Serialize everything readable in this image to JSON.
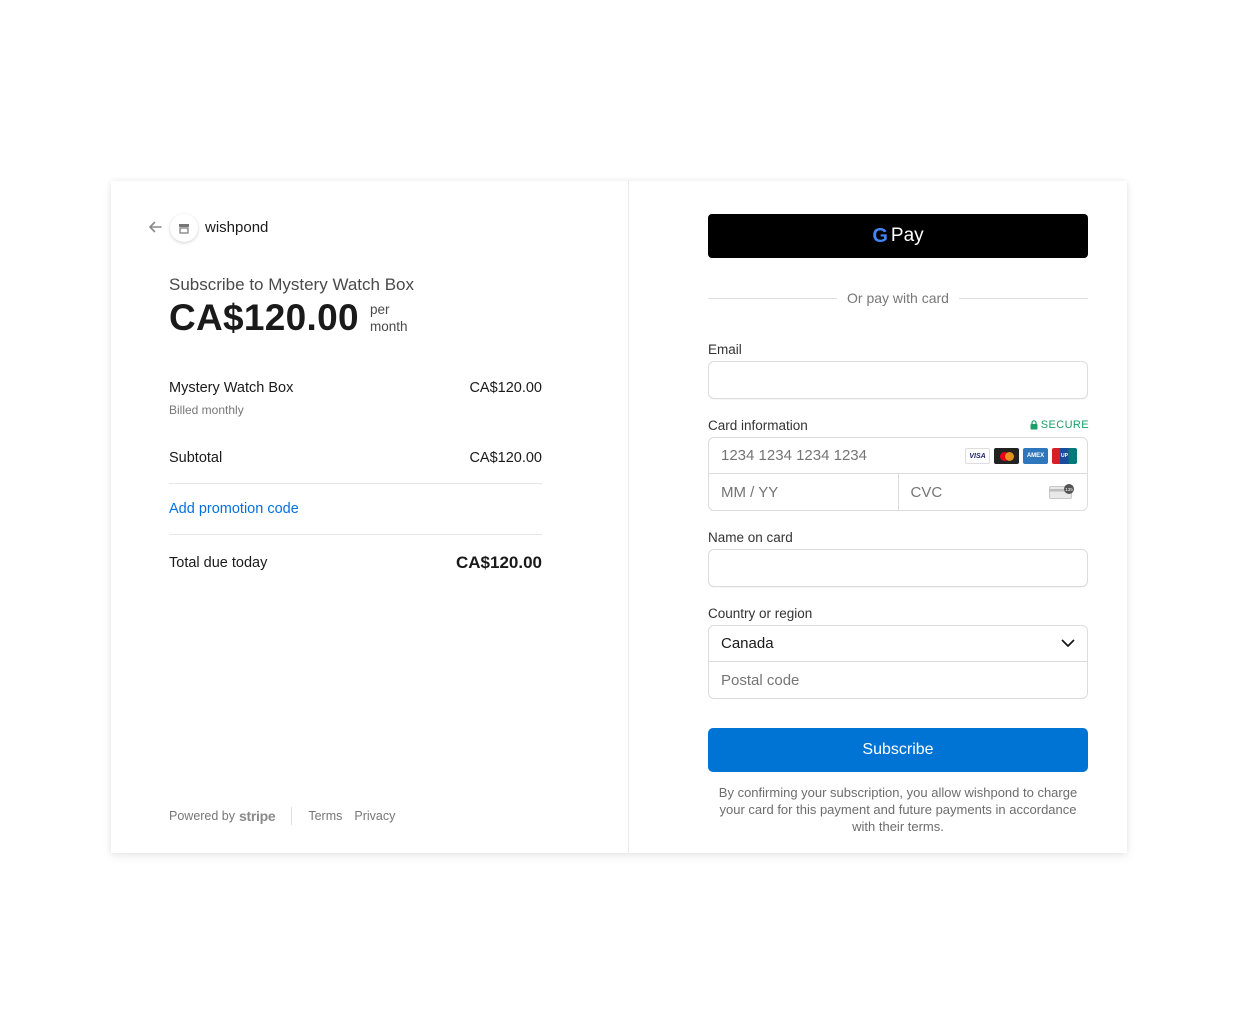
{
  "merchant": {
    "name": "wishpond"
  },
  "summary": {
    "title": "Subscribe to Mystery Watch Box",
    "price": "CA$120.00",
    "per_line1": "per",
    "per_line2": "month",
    "item_name": "Mystery Watch Box",
    "item_price": "CA$120.00",
    "item_billing": "Billed monthly",
    "subtotal_label": "Subtotal",
    "subtotal_value": "CA$120.00",
    "promo_label": "Add promotion code",
    "total_label": "Total due today",
    "total_value": "CA$120.00"
  },
  "footer": {
    "powered_by": "Powered by",
    "brand": "stripe",
    "terms": "Terms",
    "privacy": "Privacy"
  },
  "payment": {
    "gpay_label": "Pay",
    "or_text": "Or pay with card",
    "email_label": "Email",
    "email_value": "",
    "card_label": "Card information",
    "secure_label": "SECURE",
    "card_placeholder": "1234 1234 1234 1234",
    "expiry_placeholder": "MM / YY",
    "cvc_placeholder": "CVC",
    "card_brands": [
      "visa",
      "mastercard",
      "amex",
      "unionpay"
    ],
    "name_label": "Name on card",
    "name_value": "",
    "country_label": "Country or region",
    "country_value": "Canada",
    "postal_placeholder": "Postal code",
    "subscribe_label": "Subscribe",
    "terms_text": "By confirming your subscription, you allow wishpond to charge your card for this payment and future payments in accordance with their terms."
  },
  "colors": {
    "accent": "#0074d4",
    "link": "#0570de",
    "secure": "#1a9e6a",
    "gpay_bg": "#000000"
  }
}
